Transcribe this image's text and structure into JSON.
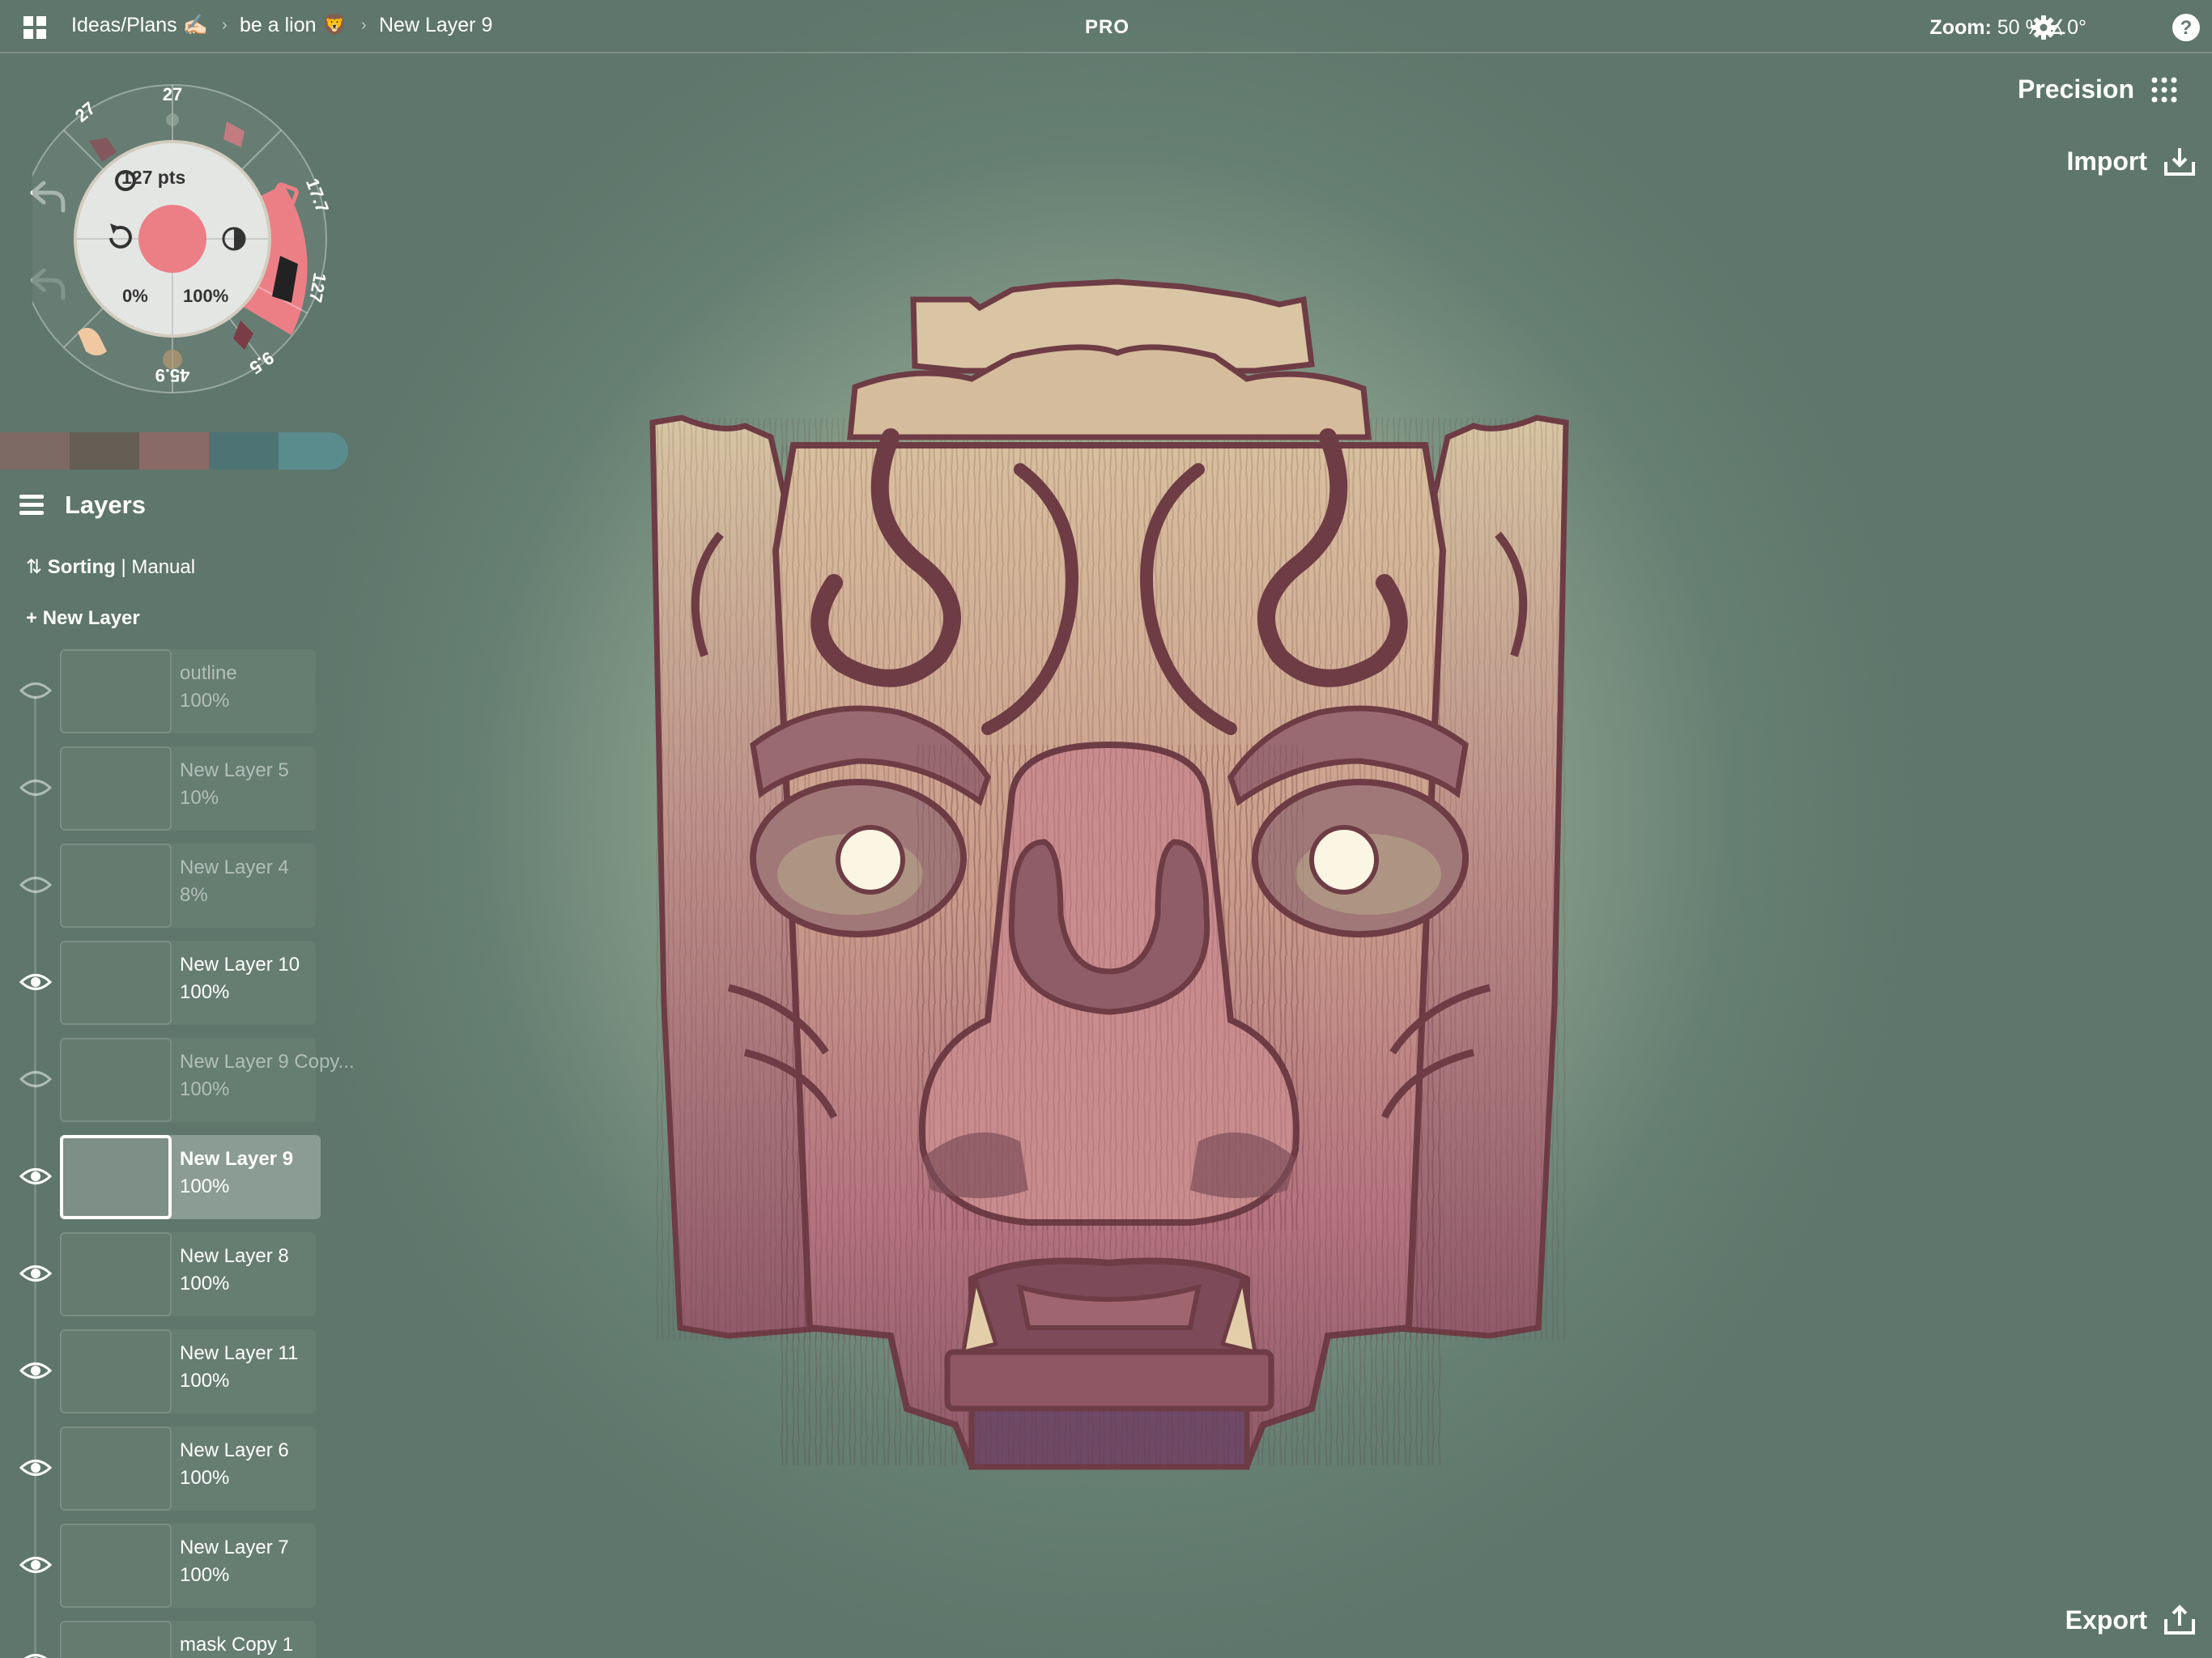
{
  "topbar": {
    "breadcrumb": [
      "Ideas/Plans ✍🏻",
      "be a lion 🦁",
      "New Layer 9"
    ],
    "pro_label": "PRO",
    "zoom_label": "Zoom:",
    "zoom_value": "50 % ∡0°"
  },
  "right_panel": {
    "precision_label": "Precision",
    "import_label": "Import",
    "export_label": "Export"
  },
  "brush_wheel": {
    "top_label": "27",
    "top_left_label": "27",
    "right_upper_label": "17.7",
    "right_active_label": "127",
    "bottom_right_label": "9.5",
    "bottom_label": "45.9",
    "size_label": "127 pts",
    "opacity_left": "0%",
    "opacity_right": "100%",
    "current_color": "#ec7f86"
  },
  "palette": {
    "colors": [
      "#7d6a64",
      "#655e55",
      "#8a6a66",
      "#4e7375",
      "#5a8c8e"
    ]
  },
  "layers": {
    "title": "Layers",
    "sorting_label": "Sorting",
    "sorting_value": "Manual",
    "new_layer_label": "New Layer",
    "items": [
      {
        "name": "outline",
        "opacity": "100%",
        "visible": false
      },
      {
        "name": "New Layer 5",
        "opacity": "10%",
        "visible": false
      },
      {
        "name": "New Layer 4",
        "opacity": "8%",
        "visible": false
      },
      {
        "name": "New Layer 10",
        "opacity": "100%",
        "visible": true
      },
      {
        "name": "New Layer 9 Copy...",
        "opacity": "100%",
        "visible": false
      },
      {
        "name": "New Layer 9",
        "opacity": "100%",
        "visible": true,
        "selected": true
      },
      {
        "name": "New Layer 8",
        "opacity": "100%",
        "visible": true
      },
      {
        "name": "New Layer 11",
        "opacity": "100%",
        "visible": true
      },
      {
        "name": "New Layer 6",
        "opacity": "100%",
        "visible": true
      },
      {
        "name": "New Layer 7",
        "opacity": "100%",
        "visible": true
      },
      {
        "name": "mask Copy 1",
        "opacity": "",
        "visible": true
      }
    ]
  },
  "colors": {
    "accent_pink": "#ec7f86",
    "mask_dark": "#6e3c45",
    "mask_mid": "#a86a70",
    "mask_light": "#d6b49a",
    "glow": "#e9e2a8"
  }
}
